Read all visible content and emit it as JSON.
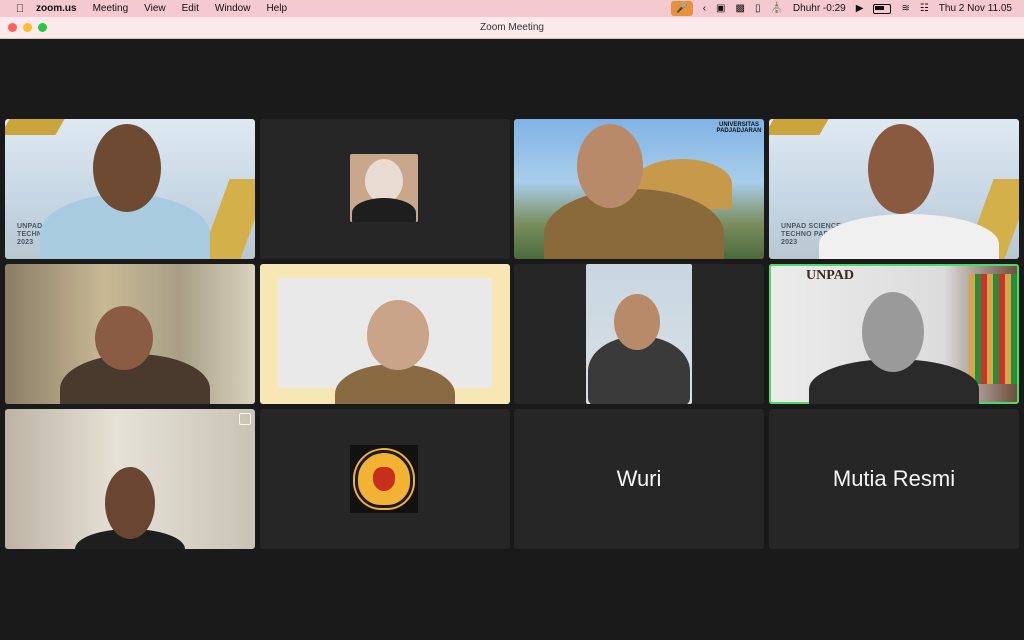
{
  "menubar": {
    "app": "zoom.us",
    "items": [
      "Meeting",
      "View",
      "Edit",
      "Window",
      "Help"
    ],
    "prayer": "Dhuhr -0:29",
    "datetime": "Thu 2 Nov  11.05"
  },
  "window": {
    "title": "Zoom Meeting"
  },
  "tiles": {
    "t1": {
      "brand_line1": "UNPAD",
      "brand_line2": "TECHNO",
      "brand_year": "2023"
    },
    "t4": {
      "brand_line1": "UNPAD SCIENCE",
      "brand_line2": "TECHNO PARK",
      "brand_year": "2023"
    },
    "t3": {
      "logo_text": "UNIVERSITAS PADJADJARAN"
    },
    "t8": {
      "logo_text": "UNPAD"
    },
    "t11": {
      "name": "Wuri"
    },
    "t12": {
      "name": "Mutia Resmi"
    }
  },
  "colors": {
    "active_speaker_border": "#4cd964",
    "menubar_bg": "#f4c9cf",
    "mic_indicator": "#e8913c"
  }
}
